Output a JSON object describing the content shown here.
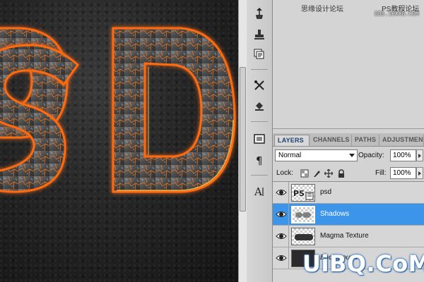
{
  "canvas": {
    "artwork_text": "psD"
  },
  "toolstrip": {
    "icons": [
      "usb-brush-icon",
      "stamp-source-icon",
      "layer-comps-icon",
      "tools-preset-icon",
      "clone-source-icon",
      "history-icon",
      "paragraph-icon",
      "character-icon"
    ]
  },
  "panel": {
    "tabs": [
      "LAYERS",
      "CHANNELS",
      "PATHS",
      "ADJUSTMENTS"
    ],
    "blend_mode": "Normal",
    "opacity_label": "Opacity:",
    "opacity_value": "100%",
    "lock_label": "Lock:",
    "fill_label": "Fill:",
    "fill_value": "100%",
    "layers": [
      {
        "name": "psd",
        "visible": true,
        "selected": false
      },
      {
        "name": "Shadows",
        "visible": true,
        "selected": true
      },
      {
        "name": "Magma Texture",
        "visible": true,
        "selected": false
      },
      {
        "name": "Background",
        "visible": true,
        "selected": false
      }
    ]
  },
  "watermark": {
    "top": "思缘设计论坛",
    "top_right": "PS教程论坛",
    "top_sub": "BBS.16XX8.COM",
    "bottom": "UiBQ.CoM"
  },
  "colors": {
    "selection": "#3d95ea",
    "lava": "#ff6a10",
    "tab_active_text": "#1f3f70"
  }
}
